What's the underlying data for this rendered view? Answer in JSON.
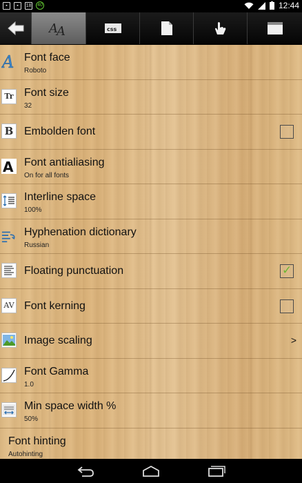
{
  "status_bar": {
    "left_icons": [
      "image-icon",
      "sd-icon",
      "notification-18-icon",
      "battery-saver-40-icon"
    ],
    "notif_badge": "18",
    "saver_badge": "40",
    "time": "12:44"
  },
  "tabs": [
    {
      "icon": "back-arrow-icon"
    },
    {
      "icon": "font-aa-icon",
      "active": true
    },
    {
      "icon": "css-icon",
      "label": "css"
    },
    {
      "icon": "page-icon"
    },
    {
      "icon": "touch-icon"
    },
    {
      "icon": "window-icon"
    }
  ],
  "settings": [
    {
      "icon": "font-face-icon",
      "glyph": "A",
      "title": "Font face",
      "value": "Roboto"
    },
    {
      "icon": "font-size-icon",
      "glyph": "Tr",
      "title": "Font size",
      "value": "32"
    },
    {
      "icon": "bold-icon",
      "glyph": "B",
      "title": "Embolden font",
      "checked": false
    },
    {
      "icon": "antialiasing-icon",
      "glyph": "A",
      "title": "Font antialiasing",
      "value": "On for all fonts"
    },
    {
      "icon": "interline-icon",
      "glyph": "≡",
      "title": "Interline space",
      "value": "100%"
    },
    {
      "icon": "hyphenation-icon",
      "glyph": "≡",
      "title": "Hyphenation dictionary",
      "value": "Russian"
    },
    {
      "icon": "punctuation-icon",
      "glyph": "≡",
      "title": "Floating punctuation",
      "checked": true
    },
    {
      "icon": "kerning-icon",
      "glyph": "AV",
      "title": "Font kerning",
      "checked": false
    },
    {
      "icon": "image-scaling-icon",
      "glyph": "▣",
      "title": "Image scaling",
      "chevron": ">"
    },
    {
      "icon": "gamma-icon",
      "glyph": "⌒",
      "title": "Font Gamma",
      "value": "1.0"
    },
    {
      "icon": "space-width-icon",
      "glyph": "⇔",
      "title": "Min space width %",
      "value": "50%"
    },
    {
      "title": "Font hinting",
      "value": "Autohinting"
    }
  ],
  "colors": {
    "check_mark": "#6ab832",
    "active_tab": "#7a7a7a"
  },
  "nav": [
    "back-icon",
    "home-icon",
    "recents-icon"
  ]
}
